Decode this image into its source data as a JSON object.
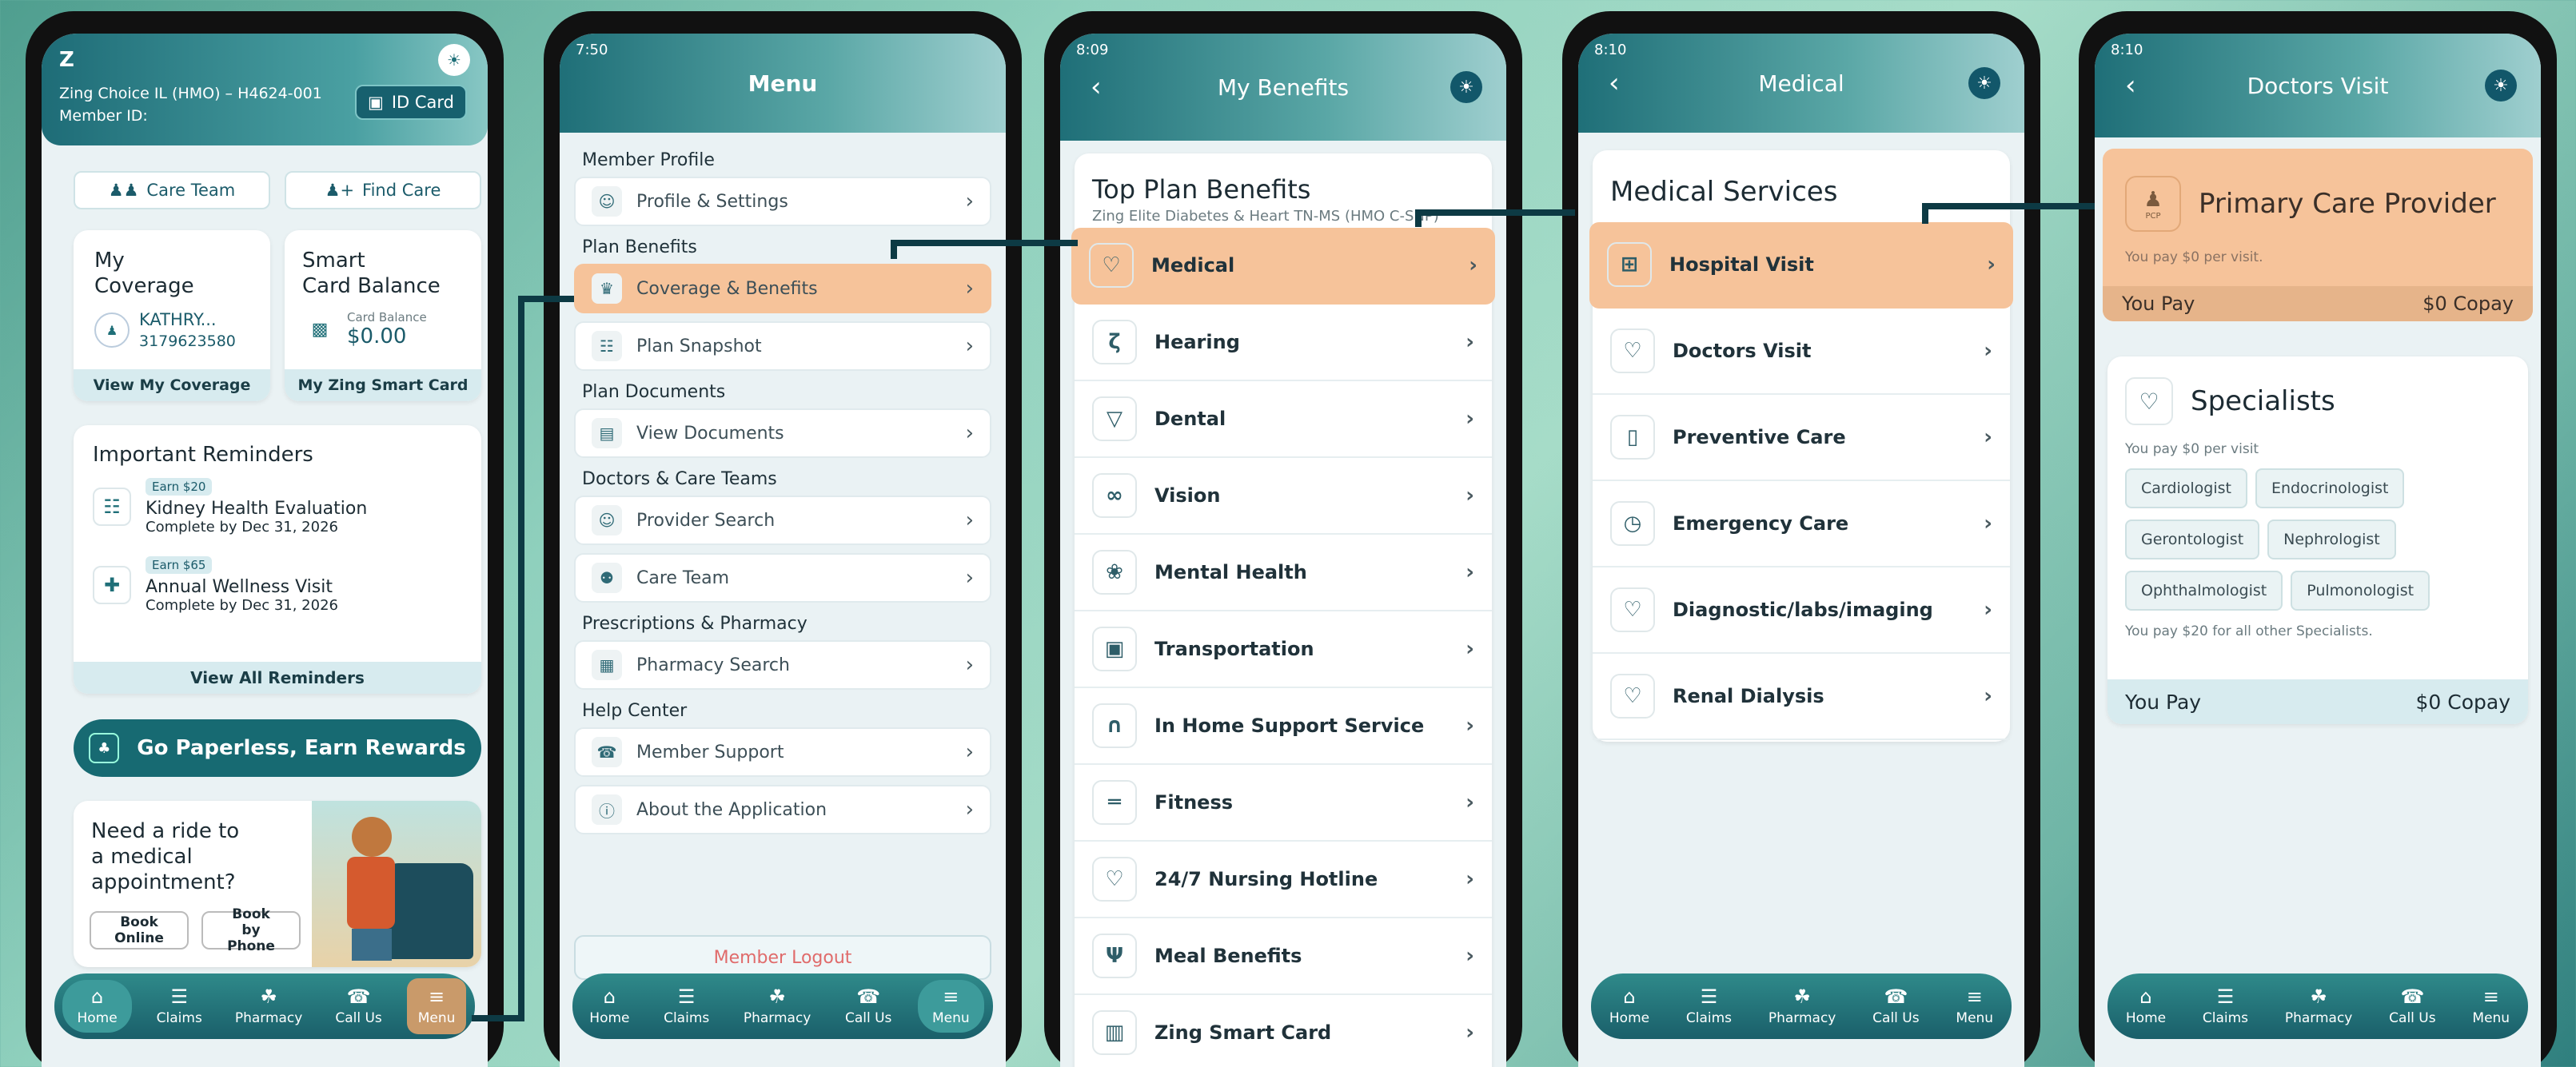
{
  "phone1": {
    "plan_name": "Zing Choice IL (HMO) – H4624-001",
    "member_id_label": "Member ID:",
    "id_card_label": "ID Card",
    "care_team_label": "Care Team",
    "find_care_label": "Find Care",
    "coverage_title": "My\nCoverage",
    "member_name": "KATHRY...",
    "member_number": "3179623580",
    "view_coverage_label": "View My Coverage",
    "smart_card_title": "Smart\nCard Balance",
    "card_balance_label": "Card Balance",
    "card_balance_value": "$0.00",
    "smart_card_link": "My Zing Smart Card",
    "reminders_title": "Important Reminders",
    "reminders": [
      {
        "badge": "Earn $20",
        "title": "Kidney Health Evaluation",
        "due": "Complete by Dec 31, 2026",
        "icon": "document-icon"
      },
      {
        "badge": "Earn $65",
        "title": "Annual Wellness Visit",
        "due": "Complete by Dec 31, 2026",
        "icon": "plus-icon"
      }
    ],
    "view_reminders_label": "View All Reminders",
    "paperless_label": "Go Paperless, Earn Rewards",
    "ride_text": "Need a ride to a medical appointment?",
    "book_online_label": "Book Online",
    "book_phone_label": "Book by Phone"
  },
  "phone2": {
    "time": "7:50",
    "title": "Menu",
    "sections": [
      {
        "title": "Member Profile",
        "items": [
          {
            "label": "Profile & Settings",
            "icon": "person-icon"
          }
        ]
      },
      {
        "title": "Plan Benefits",
        "items": [
          {
            "label": "Coverage & Benefits",
            "icon": "crown-icon",
            "highlight": true
          },
          {
            "label": "Plan Snapshot",
            "icon": "document-icon"
          }
        ]
      },
      {
        "title": "Plan Documents",
        "items": [
          {
            "label": "View Documents",
            "icon": "folder-icon"
          }
        ]
      },
      {
        "title": "Doctors & Care Teams",
        "items": [
          {
            "label": "Provider Search",
            "icon": "person-search-icon"
          },
          {
            "label": "Care Team",
            "icon": "people-icon"
          }
        ]
      },
      {
        "title": "Prescriptions & Pharmacy",
        "items": [
          {
            "label": "Pharmacy Search",
            "icon": "store-icon"
          }
        ]
      },
      {
        "title": "Help Center",
        "items": [
          {
            "label": "Member Support",
            "icon": "phone-icon"
          },
          {
            "label": "About the Application",
            "icon": "info-icon"
          }
        ]
      }
    ],
    "logout_label": "Member Logout"
  },
  "phone3": {
    "time": "8:09",
    "title": "My Benefits",
    "card_title": "Top Plan Benefits",
    "card_subtitle": "Zing Elite Diabetes & Heart TN-MS (HMO C-SNP)",
    "items": [
      {
        "label": "Medical",
        "icon": "heart-icon",
        "highlight": true
      },
      {
        "label": "Hearing",
        "icon": "ear-icon"
      },
      {
        "label": "Dental",
        "icon": "tooth-icon"
      },
      {
        "label": "Vision",
        "icon": "glasses-icon"
      },
      {
        "label": "Mental Health",
        "icon": "brain-icon"
      },
      {
        "label": "Transportation",
        "icon": "car-icon"
      },
      {
        "label": "In Home Support Service",
        "icon": "headset-icon"
      },
      {
        "label": "Fitness",
        "icon": "dumbbell-icon"
      },
      {
        "label": "24/7 Nursing Hotline",
        "icon": "heart-icon"
      },
      {
        "label": "Meal Benefits",
        "icon": "utensils-icon"
      },
      {
        "label": "Zing Smart Card",
        "icon": "cart-icon"
      }
    ]
  },
  "phone4": {
    "time": "8:10",
    "title": "Medical",
    "card_title": "Medical Services",
    "items": [
      {
        "label": "Hospital Visit",
        "icon": "hospital-icon",
        "highlight": true
      },
      {
        "label": "Doctors Visit",
        "icon": "heart-icon"
      },
      {
        "label": "Preventive Care",
        "icon": "bottle-icon"
      },
      {
        "label": "Emergency Care",
        "icon": "alarm-icon"
      },
      {
        "label": "Diagnostic/labs/imaging",
        "icon": "heart-icon"
      },
      {
        "label": "Renal Dialysis",
        "icon": "heart-icon"
      }
    ]
  },
  "phone5": {
    "time": "8:10",
    "title": "Doctors Visit",
    "pcp_title": "Primary Care Provider",
    "pcp_icon_label": "PCP",
    "pcp_note": "You pay $0 per visit.",
    "pcp_pay_label": "You Pay",
    "pcp_pay_value": "$0 Copay",
    "spec_title": "Specialists",
    "spec_note": "You pay $0 per visit",
    "specialists": [
      "Cardiologist",
      "Endocrinologist",
      "Gerontologist",
      "Nephrologist",
      "Ophthalmologist",
      "Pulmonologist"
    ],
    "spec_other_note": "You pay $20 for all other Specialists.",
    "spec_pay_label": "You Pay",
    "spec_pay_value": "$0 Copay"
  },
  "nav": [
    "Home",
    "Claims",
    "Pharmacy",
    "Call Us",
    "Menu"
  ],
  "nav_icons": [
    "home-icon",
    "claims-icon",
    "pharmacy-icon",
    "phone-icon",
    "menu-icon"
  ],
  "colors": {
    "accent": "#1f6f78",
    "highlight": "#f6c39a",
    "logout": "#e06b6b"
  }
}
